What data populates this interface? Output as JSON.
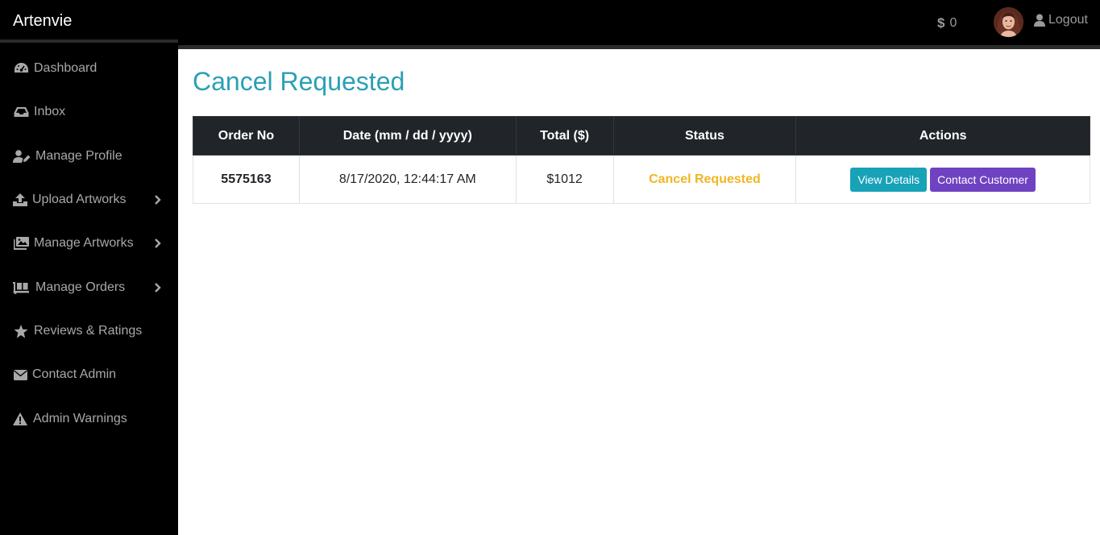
{
  "header": {
    "brand": "Artenvie",
    "balance": "0",
    "logout_label": "Logout"
  },
  "sidebar": {
    "items": [
      {
        "label": "Dashboard",
        "icon": "dashboard-icon",
        "submenu": false
      },
      {
        "label": "Inbox",
        "icon": "inbox-icon",
        "submenu": false
      },
      {
        "label": "Manage Profile",
        "icon": "user-edit-icon",
        "submenu": false
      },
      {
        "label": "Upload Artworks",
        "icon": "upload-icon",
        "submenu": true
      },
      {
        "label": "Manage Artworks",
        "icon": "images-icon",
        "submenu": true
      },
      {
        "label": "Manage Orders",
        "icon": "dolly-icon",
        "submenu": true
      },
      {
        "label": "Reviews & Ratings",
        "icon": "star-icon",
        "submenu": false
      },
      {
        "label": "Contact Admin",
        "icon": "envelope-icon",
        "submenu": false
      },
      {
        "label": "Admin Warnings",
        "icon": "warning-icon",
        "submenu": false
      }
    ]
  },
  "main": {
    "title": "Cancel Requested",
    "table": {
      "headers": [
        "Order No",
        "Date (mm / dd / yyyy)",
        "Total ($)",
        "Status",
        "Actions"
      ],
      "rows": [
        {
          "order_no": "5575163",
          "date": "8/17/2020, 12:44:17 AM",
          "total": "$1012",
          "status": "Cancel Requested",
          "view_label": "View Details",
          "contact_label": "Contact Customer"
        }
      ]
    }
  },
  "colors": {
    "accent": "#2aa0b5",
    "status": "#f0b623",
    "view_button": "#17a2b8",
    "contact_button": "#6f42c1",
    "table_header": "#212529"
  }
}
